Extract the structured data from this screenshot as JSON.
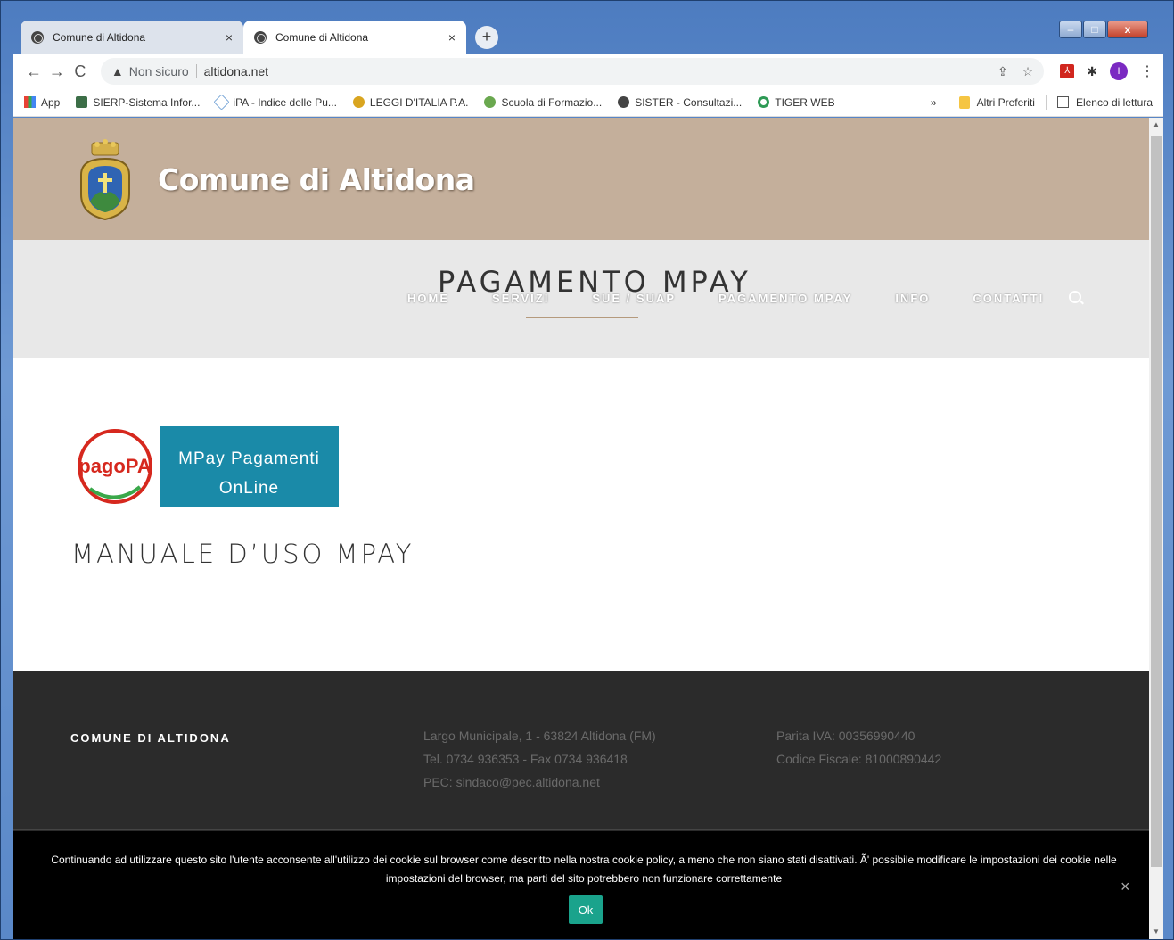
{
  "browser": {
    "tabs": [
      {
        "title": "Comune di Altidona",
        "close": "×"
      },
      {
        "title": "Comune di Altidona",
        "close": "×"
      }
    ],
    "new_tab": "+",
    "window_controls": {
      "minimize": "–",
      "maximize": "□",
      "close": "x"
    },
    "nav": {
      "back": "←",
      "forward": "→",
      "reload": "C"
    },
    "address": {
      "security_label": "Non sicuro",
      "url": "altidona.net"
    },
    "profile_initial": "I",
    "bookmarks": [
      {
        "label": "App",
        "color": "#e94235"
      },
      {
        "label": "SIERP-Sistema Infor...",
        "color": "#3c6e47"
      },
      {
        "label": "iPA - Indice delle Pu...",
        "color": "#7aa7d8"
      },
      {
        "label": "LEGGI D'ITALIA P.A.",
        "color": "#d9a520"
      },
      {
        "label": "Scuola di Formazio...",
        "color": "#6aa84f"
      },
      {
        "label": "SISTER - Consultazi...",
        "color": "#444444"
      },
      {
        "label": "TIGER WEB",
        "color": "#2e9a55"
      }
    ],
    "bookmarks_overflow": "»",
    "other_bookmarks": "Altri Preferiti",
    "reading_list": "Elenco di lettura"
  },
  "site": {
    "name": "Comune di Altidona",
    "page_title": "PAGAMENTO MPAY",
    "menu": [
      "HOME",
      "SERVIZI",
      "SUE / SUAP",
      "PAGAMENTO MPAY",
      "INFO",
      "CONTATTI"
    ],
    "pagopa_logo_text": "pagoPA",
    "mpay_button": {
      "line1": "MPay Pagamenti",
      "line2": "OnLine"
    },
    "manual_heading": "MANUALE D’USO MPAY"
  },
  "footer": {
    "brand": "COMUNE DI ALTIDONA",
    "address_lines": [
      "Largo Municipale, 1 - 63824 Altidona (FM)",
      "Tel. 0734 936353 - Fax 0734 936418",
      "PEC: sindaco@pec.altidona.net"
    ],
    "fiscal_lines": [
      "Parita IVA: 00356990440",
      "Codice Fiscale: 81000890442"
    ]
  },
  "cookie_banner": {
    "text": "Continuando ad utilizzare questo sito l'utente acconsente all'utilizzo dei cookie sul browser come descritto nella nostra cookie policy, a meno che non siano stati disattivati. Ã' possibile modificare le impostazioni dei cookie nelle impostazioni del browser, ma parti del sito potrebbero non funzionare correttamente",
    "ok_label": "Ok",
    "close": "×"
  },
  "colors": {
    "header_bg": "#c4af9b",
    "nav_bg": "#e8e8e8",
    "mpay_blue": "#1a8aa8",
    "footer_bg": "#2b2b2b",
    "ok_green": "#1aa38c"
  }
}
